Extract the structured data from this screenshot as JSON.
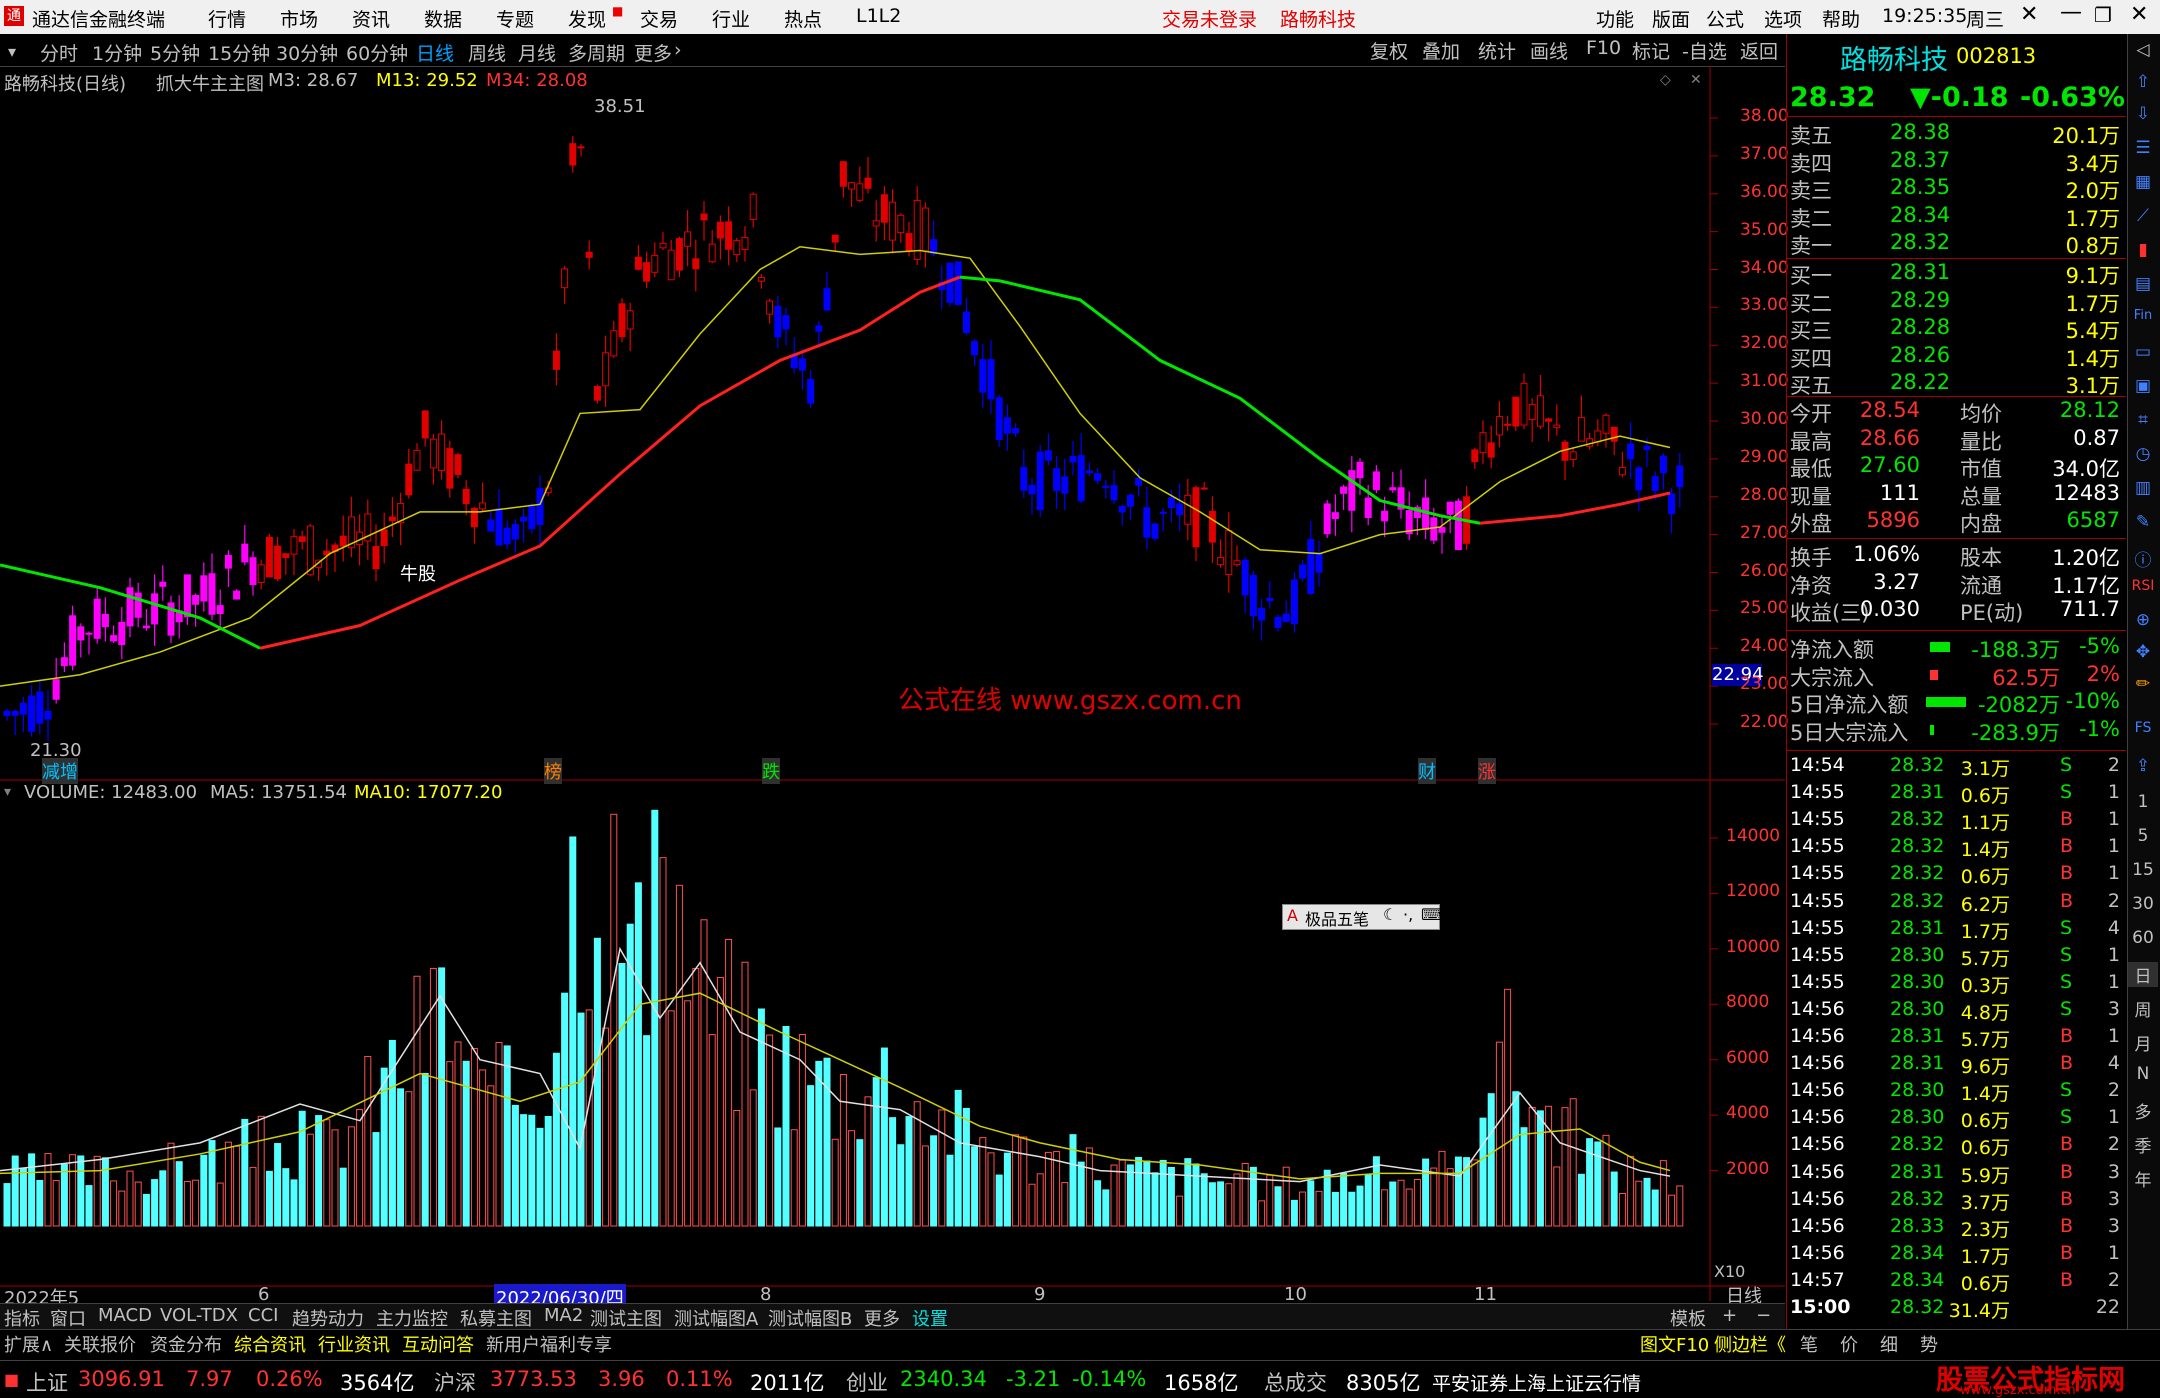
{
  "window": {
    "app_title": "通达信金融终端",
    "menu": [
      "行情",
      "市场",
      "资讯",
      "数据",
      "专题",
      "发现",
      "交易",
      "行业",
      "热点",
      "L1L2"
    ],
    "login_status": "交易未登录",
    "stock_title": "路畅科技",
    "right_menu": [
      "功能",
      "版面",
      "公式",
      "选项",
      "帮助"
    ],
    "clock": "19:25:35",
    "weekday": "周三"
  },
  "period_bar": {
    "periods": [
      "分时",
      "1分钟",
      "5分钟",
      "15分钟",
      "30分钟",
      "60分钟",
      "日线",
      "周线",
      "月线",
      "多周期",
      "更多"
    ],
    "selected": "日线",
    "tools": [
      "复权",
      "叠加",
      "统计",
      "画线",
      "F10",
      "标记",
      "-自选",
      "返回"
    ]
  },
  "main_chart": {
    "header": {
      "stock": "路畅科技(日线)",
      "formula": "抓大牛主主图",
      "m3": "M3: 28.67",
      "m13": "M13: 29.52",
      "m34": "M34: 28.08"
    },
    "high_label": "38.51",
    "low_label": "21.30",
    "signal_label": "牛股",
    "watermark": "公式在线  www.gszx.com.cn",
    "current_price_tag": "22.94",
    "event_labels": [
      "减增",
      "榜",
      "跌",
      "财",
      "涨"
    ],
    "y_ticks": [
      "38.00",
      "37.00",
      "36.00",
      "35.00",
      "34.00",
      "33.00",
      "32.00",
      "31.00",
      "30.00",
      "29.00",
      "28.00",
      "27.00",
      "26.00",
      "25.00",
      "24.00",
      "23.00",
      "22.00"
    ]
  },
  "volume_chart": {
    "header": {
      "volume": "VOLUME: 12483.00",
      "ma5": "MA5: 13751.54",
      "ma10": "MA10: 17077.20"
    },
    "y_ticks": [
      "14000",
      "12000",
      "10000",
      "8000",
      "6000",
      "4000",
      "2000"
    ],
    "unit": "X10",
    "ime_toolbar": "极品五笔"
  },
  "x_axis": {
    "labels": [
      "2022年5",
      "6",
      "2022/06/30/四",
      "8",
      "9",
      "10",
      "11"
    ],
    "period": "日线"
  },
  "bottom_tabs": {
    "row1": [
      "指标",
      "窗口",
      "MACD",
      "VOL-TDX",
      "CCI",
      "趋势动力",
      "主力监控",
      "私募主图",
      "MA2",
      "测试主图",
      "测试幅图A",
      "测试幅图B",
      "更多",
      "设置"
    ],
    "row1_right": "模板",
    "row2": [
      "扩展∧",
      "关联报价",
      "资金分布",
      "综合资讯",
      "行业资讯",
      "互动问答",
      "新用户福利专享"
    ],
    "row2_right": [
      "图文F10",
      "侧边栏《",
      "笔",
      "价",
      "细",
      "势"
    ]
  },
  "quote": {
    "name": "路畅科技",
    "code": "002813",
    "price": "28.32",
    "change": "▼-0.18",
    "change_pct": "-0.63%",
    "asks": [
      {
        "label": "卖五",
        "price": "28.38",
        "vol": "20.1万"
      },
      {
        "label": "卖四",
        "price": "28.37",
        "vol": "3.4万"
      },
      {
        "label": "卖三",
        "price": "28.35",
        "vol": "2.0万"
      },
      {
        "label": "卖二",
        "price": "28.34",
        "vol": "1.7万"
      },
      {
        "label": "卖一",
        "price": "28.32",
        "vol": "0.8万"
      }
    ],
    "bids": [
      {
        "label": "买一",
        "price": "28.31",
        "vol": "9.1万"
      },
      {
        "label": "买二",
        "price": "28.29",
        "vol": "1.7万"
      },
      {
        "label": "买三",
        "price": "28.28",
        "vol": "5.4万"
      },
      {
        "label": "买四",
        "price": "28.26",
        "vol": "1.4万"
      },
      {
        "label": "买五",
        "price": "28.22",
        "vol": "3.1万"
      }
    ],
    "stats": [
      {
        "l1": "今开",
        "v1": "28.54",
        "l2": "均价",
        "v2": "28.12"
      },
      {
        "l1": "最高",
        "v1": "28.66",
        "l2": "量比",
        "v2": "0.87"
      },
      {
        "l1": "最低",
        "v1": "27.60",
        "l2": "市值",
        "v2": "34.0亿"
      },
      {
        "l1": "现量",
        "v1": "111",
        "l2": "总量",
        "v2": "12483"
      },
      {
        "l1": "外盘",
        "v1": "5896",
        "l2": "内盘",
        "v2": "6587"
      }
    ],
    "stats2": [
      {
        "l1": "换手",
        "v1": "1.06%",
        "l2": "股本",
        "v2": "1.20亿"
      },
      {
        "l1": "净资",
        "v1": "3.27",
        "l2": "流通",
        "v2": "1.17亿"
      },
      {
        "l1": "收益(三)",
        "v1": "0.030",
        "l2": "PE(动)",
        "v2": "711.7"
      }
    ],
    "flows": [
      {
        "label": "净流入额",
        "value": "-188.3万",
        "pct": "-5%"
      },
      {
        "label": "大宗流入",
        "value": "62.5万",
        "pct": "2%"
      },
      {
        "label": "5日净流入额",
        "value": "-2082万",
        "pct": "-10%"
      },
      {
        "label": "5日大宗流入",
        "value": "-283.9万",
        "pct": "-1%"
      }
    ],
    "ticks": [
      {
        "t": "14:54",
        "p": "28.32",
        "v": "3.1万",
        "s": "S",
        "n": "2"
      },
      {
        "t": "14:55",
        "p": "28.31",
        "v": "0.6万",
        "s": "S",
        "n": "1"
      },
      {
        "t": "14:55",
        "p": "28.32",
        "v": "1.1万",
        "s": "B",
        "n": "1"
      },
      {
        "t": "14:55",
        "p": "28.32",
        "v": "1.4万",
        "s": "B",
        "n": "1"
      },
      {
        "t": "14:55",
        "p": "28.32",
        "v": "0.6万",
        "s": "B",
        "n": "1"
      },
      {
        "t": "14:55",
        "p": "28.32",
        "v": "6.2万",
        "s": "B",
        "n": "2"
      },
      {
        "t": "14:55",
        "p": "28.31",
        "v": "1.7万",
        "s": "S",
        "n": "4"
      },
      {
        "t": "14:55",
        "p": "28.30",
        "v": "5.7万",
        "s": "S",
        "n": "1"
      },
      {
        "t": "14:55",
        "p": "28.30",
        "v": "0.3万",
        "s": "S",
        "n": "1"
      },
      {
        "t": "14:56",
        "p": "28.30",
        "v": "4.8万",
        "s": "S",
        "n": "3"
      },
      {
        "t": "14:56",
        "p": "28.31",
        "v": "5.7万",
        "s": "B",
        "n": "1"
      },
      {
        "t": "14:56",
        "p": "28.31",
        "v": "9.6万",
        "s": "B",
        "n": "4"
      },
      {
        "t": "14:56",
        "p": "28.30",
        "v": "1.4万",
        "s": "S",
        "n": "2"
      },
      {
        "t": "14:56",
        "p": "28.30",
        "v": "0.6万",
        "s": "S",
        "n": "1"
      },
      {
        "t": "14:56",
        "p": "28.32",
        "v": "0.6万",
        "s": "B",
        "n": "2"
      },
      {
        "t": "14:56",
        "p": "28.31",
        "v": "5.9万",
        "s": "B",
        "n": "3"
      },
      {
        "t": "14:56",
        "p": "28.32",
        "v": "3.7万",
        "s": "B",
        "n": "3"
      },
      {
        "t": "14:56",
        "p": "28.33",
        "v": "2.3万",
        "s": "B",
        "n": "3"
      },
      {
        "t": "14:56",
        "p": "28.34",
        "v": "1.7万",
        "s": "B",
        "n": "1"
      },
      {
        "t": "14:57",
        "p": "28.34",
        "v": "0.6万",
        "s": "B",
        "n": "2"
      },
      {
        "t": "15:00",
        "p": "28.32",
        "v": "31.4万",
        "s": "",
        "n": "22"
      }
    ]
  },
  "side_tools": [
    "RSI",
    "FS",
    "1",
    "5",
    "15",
    "30",
    "60",
    "日",
    "周",
    "月",
    "N",
    "多",
    "季",
    "年"
  ],
  "status_bar": {
    "sh_name": "上证",
    "sh_val": "3096.91",
    "sh_chg": "7.97",
    "sh_pct": "0.26%",
    "sh_amt": "3564亿",
    "sz_name": "沪深",
    "sz_val": "3773.53",
    "sz_chg": "3.96",
    "sz_pct": "0.11%",
    "sz_amt": "2011亿",
    "cy_name": "创业",
    "cy_val": "2340.34",
    "cy_chg": "-3.21",
    "cy_pct": "-0.14%",
    "cy_amt": "1658亿",
    "total_label": "总成交",
    "total_val": "8305亿",
    "broker": "平安证券上海上证云行情",
    "brand": "股票公式指标网",
    "brand_url": "www.gszx.com.cn"
  }
}
